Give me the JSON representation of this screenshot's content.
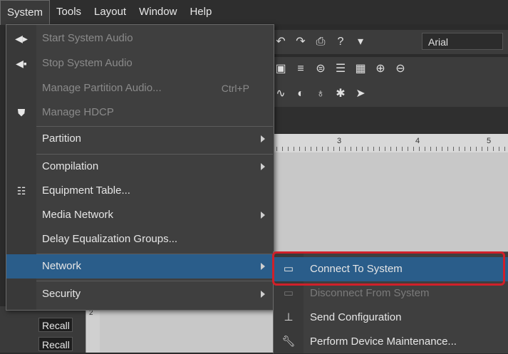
{
  "menubar": {
    "items": [
      {
        "label": "System"
      },
      {
        "label": "Tools"
      },
      {
        "label": "Layout"
      },
      {
        "label": "Window"
      },
      {
        "label": "Help"
      }
    ]
  },
  "toolbar": {
    "font_value": "Arial",
    "ruler_numbers": [
      "3",
      "4",
      "5"
    ],
    "vruler_number": "2"
  },
  "left_panel": {
    "recall_labels": [
      "Recall",
      "Recall"
    ]
  },
  "system_menu": {
    "items": [
      {
        "label": "Start System Audio",
        "icon": "speaker-play-icon",
        "disabled": true
      },
      {
        "label": "Stop System Audio",
        "icon": "speaker-stop-icon",
        "disabled": true
      },
      {
        "label": "Manage Partition Audio...",
        "shortcut": "Ctrl+P",
        "disabled": true
      },
      {
        "label": "Manage HDCP",
        "icon": "shield-icon",
        "disabled": true
      },
      {
        "label": "Partition",
        "submenu": true
      },
      {
        "label": "Compilation",
        "submenu": true
      },
      {
        "label": "Equipment Table...",
        "icon": "table-icon"
      },
      {
        "label": "Media Network",
        "submenu": true
      },
      {
        "label": "Delay Equalization Groups..."
      },
      {
        "label": "Network",
        "submenu": true,
        "highlighted": true
      },
      {
        "label": "Security",
        "submenu": true
      }
    ]
  },
  "network_submenu": {
    "items": [
      {
        "label": "Connect To System",
        "icon": "connect-icon",
        "highlighted": true
      },
      {
        "label": "Disconnect From System",
        "icon": "disconnect-icon",
        "disabled": true
      },
      {
        "label": "Send Configuration",
        "icon": "network-tree-icon"
      },
      {
        "label": "Perform Device Maintenance...",
        "icon": "wrench-icon"
      }
    ]
  },
  "colors": {
    "highlight": "#2a5d8a",
    "annotation_outline": "#d0202a"
  }
}
